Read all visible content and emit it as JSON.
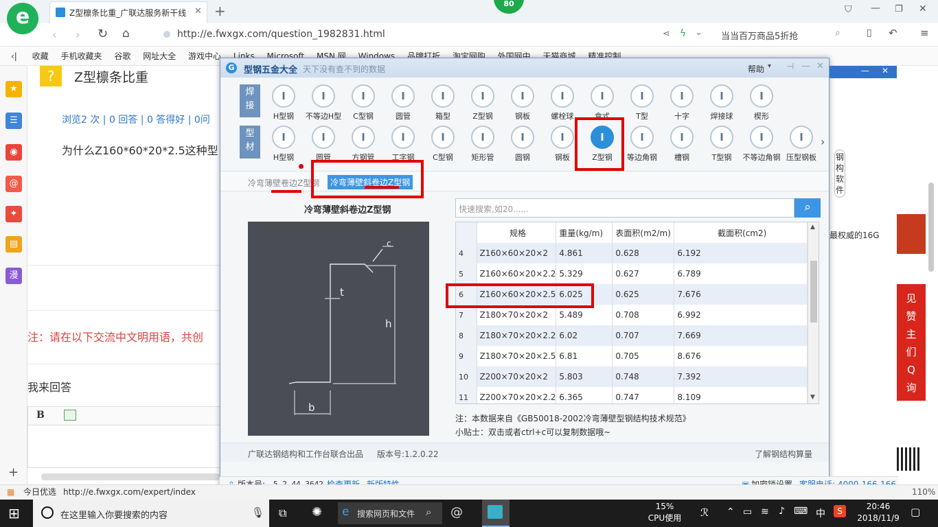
{
  "browser": {
    "score_badge": "80",
    "tab_title": "Z型檩条比重_广联达服务新干线",
    "url": "http://e.fwxgx.com/question_1982831.html",
    "search_hint": "当当百万商品5折抢",
    "bookmarks": [
      "收藏",
      "手机收藏夹",
      "谷歌",
      "网址大全",
      "游戏中心",
      "Links",
      "Microsoft",
      "MSN 网",
      "Windows",
      "品牌打折",
      "淘宝网购",
      "外国网中",
      "天猫商城",
      "精准控制"
    ],
    "status_left": "今日优选",
    "status_url": "http://e.fwxgx.com/expert/index",
    "zoom": "110%"
  },
  "page": {
    "question_title": "Z型檩条比重",
    "meta": "浏览2 次 | 0 回答 | 0 答得好 | 0问",
    "question_body": "为什么Z160*60*20*2.5这种型",
    "notice": "注：请在以下交流中文明用语，共创",
    "answer_label": "我来回答",
    "bold_btn": "B",
    "right_side_text": "最权威的16G",
    "right_ad_chars": [
      "见",
      "赞",
      "主",
      "们",
      "Q",
      "询"
    ]
  },
  "dialog": {
    "title": "型钢五金大全",
    "subtitle": "天下没有查不到的数据",
    "help": "帮助",
    "group_weld": "焊接",
    "group_profile": "型材",
    "row1": [
      "H型钢",
      "不等边H型",
      "C型钢",
      "圆管",
      "箱型",
      "Z型钢",
      "钢板",
      "螺栓球",
      "盒式",
      "T型",
      "十字",
      "焊接球",
      "楔形"
    ],
    "row2": [
      "H型钢",
      "圆管",
      "方钢管",
      "工字钢",
      "C型钢",
      "矩形管",
      "圆钢",
      "钢板",
      "Z型钢",
      "等边角钢",
      "槽钢",
      "T型钢",
      "不等边角钢",
      "压型钢板"
    ],
    "subtabs": [
      "冷弯薄壁卷边Z型钢",
      "冷弯薄壁斜卷边Z型钢"
    ],
    "diagram_title": "冷弯薄壁斜卷边Z型钢",
    "diagram_labels": {
      "t": "t",
      "h": "h",
      "b": "b",
      "c": "c"
    },
    "search_placeholder": "快速搜索,如20......",
    "table": {
      "headers": [
        "规格",
        "重量(kg/m)",
        "表面积(m2/m)",
        "截面积(cm2)"
      ],
      "rows": [
        {
          "idx": "4",
          "spec": "Z160×60×20×2",
          "weight": "4.861",
          "area": "0.628",
          "section": "6.192"
        },
        {
          "idx": "5",
          "spec": "Z160×60×20×2.2",
          "weight": "5.329",
          "area": "0.627",
          "section": "6.789"
        },
        {
          "idx": "6",
          "spec": "Z160×60×20×2.5",
          "weight": "6.025",
          "area": "0.625",
          "section": "7.676"
        },
        {
          "idx": "7",
          "spec": "Z180×70×20×2",
          "weight": "5.489",
          "area": "0.708",
          "section": "6.992"
        },
        {
          "idx": "8",
          "spec": "Z180×70×20×2.2",
          "weight": "6.02",
          "area": "0.707",
          "section": "7.669"
        },
        {
          "idx": "9",
          "spec": "Z180×70×20×2.5",
          "weight": "6.81",
          "area": "0.705",
          "section": "8.676"
        },
        {
          "idx": "10",
          "spec": "Z200×70×20×2",
          "weight": "5.803",
          "area": "0.748",
          "section": "7.392"
        },
        {
          "idx": "11",
          "spec": "Z200×70×20×2.2",
          "weight": "6.365",
          "area": "0.747",
          "section": "8.109"
        }
      ]
    },
    "note": "注：本数据来自《GB50018-2002冷弯薄壁型钢结构技术规范》",
    "tip": "小贴士：双击或者ctrl+c可以复制数据哦~",
    "footer_left": "广联达钢结构和工作台联合出品",
    "footer_version": "版本号:1.2.0.22",
    "footer_right": "了解钢结构算量",
    "mascot": "钢构软件"
  },
  "appbar": {
    "version_label": "版本号:",
    "version": "5.2.44.3642",
    "check_update": "检查更新",
    "new_features": "新版特性",
    "lock": "加密锁设置",
    "hotline": "客服电话: 4000-166-166"
  },
  "taskbar": {
    "search_placeholder": "在这里输入你要搜索的内容",
    "web_search": "搜索网页和文件",
    "cpu_pct": "15%",
    "cpu_label": "CPU使用",
    "ime": "中",
    "time": "20:46",
    "date": "2018/11/9"
  },
  "colors": {
    "accent": "#2b8fd9",
    "highlight_red": "#e10000",
    "link_blue": "#1a73c8",
    "notice_red": "#e04040"
  }
}
